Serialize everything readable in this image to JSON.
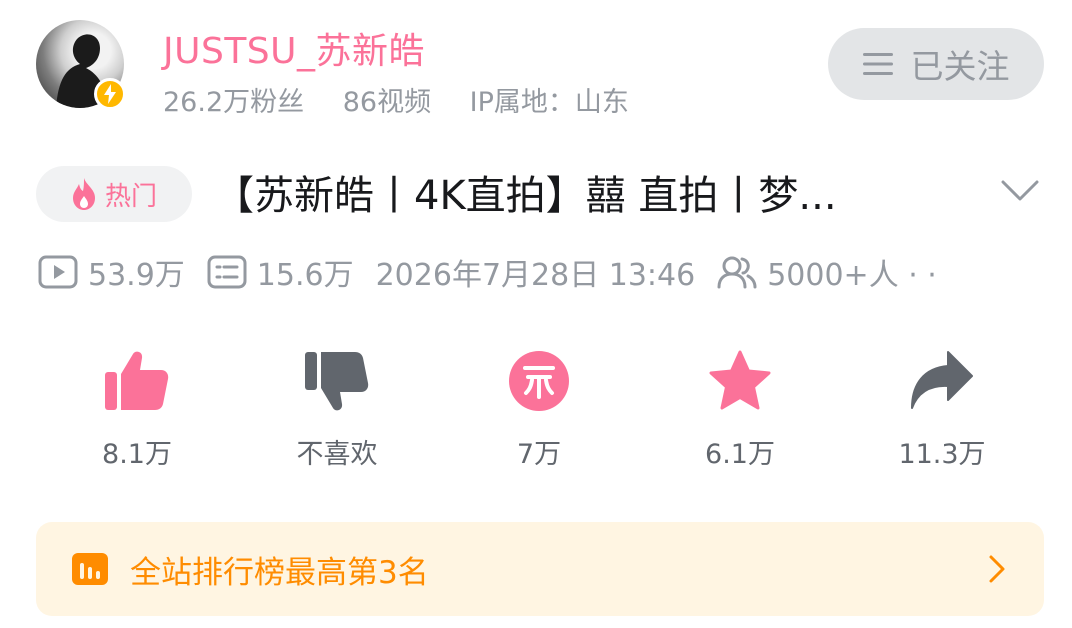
{
  "user": {
    "name": "JUSTSU_苏新皓",
    "followers": "26.2万粉丝",
    "videos": "86视频",
    "ip": "IP属地：山东",
    "follow_label": "已关注"
  },
  "video": {
    "hot_tag": "热门",
    "title": "【苏新皓丨4K直拍】囍 直拍丨梦...",
    "plays": "53.9万",
    "danmaku": "15.6万",
    "date": "2026年7月28日 13:46",
    "watching": "5000+人 · ·"
  },
  "actions": {
    "like": "8.1万",
    "dislike": "不喜欢",
    "coin": "7万",
    "favorite": "6.1万",
    "share": "11.3万"
  },
  "rank": {
    "text": "全站排行榜最高第3名"
  },
  "colors": {
    "pink": "#fb7299",
    "gray_text": "#9499a0",
    "orange": "#ff8c00",
    "banner_bg": "#fff5e2",
    "badge_yellow": "#ffb800"
  }
}
